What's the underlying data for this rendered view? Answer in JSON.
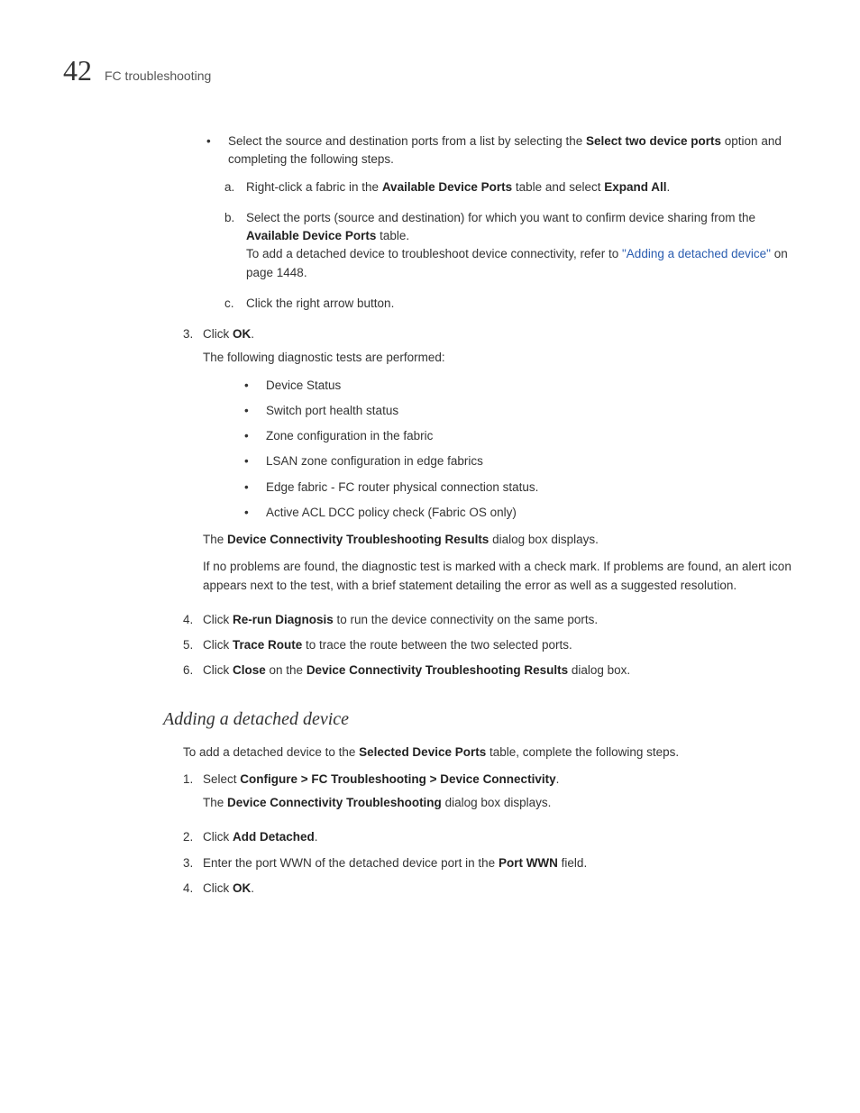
{
  "header": {
    "chapter": "42",
    "section": "FC troubleshooting"
  },
  "top_bullet": {
    "pre": "Select the source and destination ports from a list by selecting the ",
    "bold1": "Select two device ports",
    "post": " option and completing the following steps."
  },
  "letters": {
    "a": {
      "pre": "Right-click a fabric in the ",
      "bold1": "Available Device Ports",
      "mid": " table and select ",
      "bold2": "Expand All",
      "post": "."
    },
    "b": {
      "pre": "Select the ports (source and destination) for which you want to confirm device sharing from the ",
      "bold1": "Available Device Ports",
      "post": " table.",
      "line2_pre": "To add a detached device to troubleshoot device connectivity, refer to ",
      "link": "\"Adding a detached device\"",
      "line2_post": " on page 1448."
    },
    "c": "Click the right arrow button."
  },
  "step3": {
    "pre": "Click ",
    "bold": "OK",
    "post": ".",
    "follow": "The following diagnostic tests are performed:",
    "tests": [
      "Device Status",
      "Switch port health status",
      "Zone configuration in the fabric",
      "LSAN zone configuration in edge fabrics",
      "Edge fabric - FC router physical connection status.",
      "Active ACL DCC policy check (Fabric OS only)"
    ],
    "results_pre": "The ",
    "results_bold": "Device Connectivity Troubleshooting Results",
    "results_post": " dialog box displays.",
    "noproblems": "If no problems are found, the diagnostic test is marked with a check mark. If problems are found, an alert icon appears next to the test, with a brief statement detailing the error as well as a suggested resolution."
  },
  "step4": {
    "pre": "Click ",
    "bold": "Re-run Diagnosis",
    "post": " to run the device connectivity on the same ports."
  },
  "step5": {
    "pre": "Click ",
    "bold": "Trace Route",
    "post": " to trace the route between the two selected ports."
  },
  "step6": {
    "pre": "Click ",
    "bold1": "Close",
    "mid": " on the ",
    "bold2": "Device Connectivity Troubleshooting Results",
    "post": " dialog box."
  },
  "h2": "Adding a detached device",
  "intro": {
    "pre": "To add a detached device to the ",
    "bold": "Selected Device Ports",
    "post": " table, complete the following steps."
  },
  "add": {
    "s1": {
      "pre": "Select ",
      "bold": "Configure > FC Troubleshooting > Device Connectivity",
      "post": ".",
      "line2_pre": "The ",
      "line2_bold": "Device Connectivity Troubleshooting",
      "line2_post": " dialog box displays."
    },
    "s2": {
      "pre": "Click ",
      "bold": "Add Detached",
      "post": "."
    },
    "s3": {
      "pre": "Enter the port WWN of the detached device port in the ",
      "bold": "Port WWN",
      "post": " field."
    },
    "s4": {
      "pre": "Click ",
      "bold": "OK",
      "post": "."
    }
  },
  "markers": {
    "n3": "3.",
    "n4": "4.",
    "n5": "5.",
    "n6": "6.",
    "a": "a.",
    "b": "b.",
    "c": "c.",
    "add1": "1.",
    "add2": "2.",
    "add3": "3.",
    "add4": "4."
  }
}
